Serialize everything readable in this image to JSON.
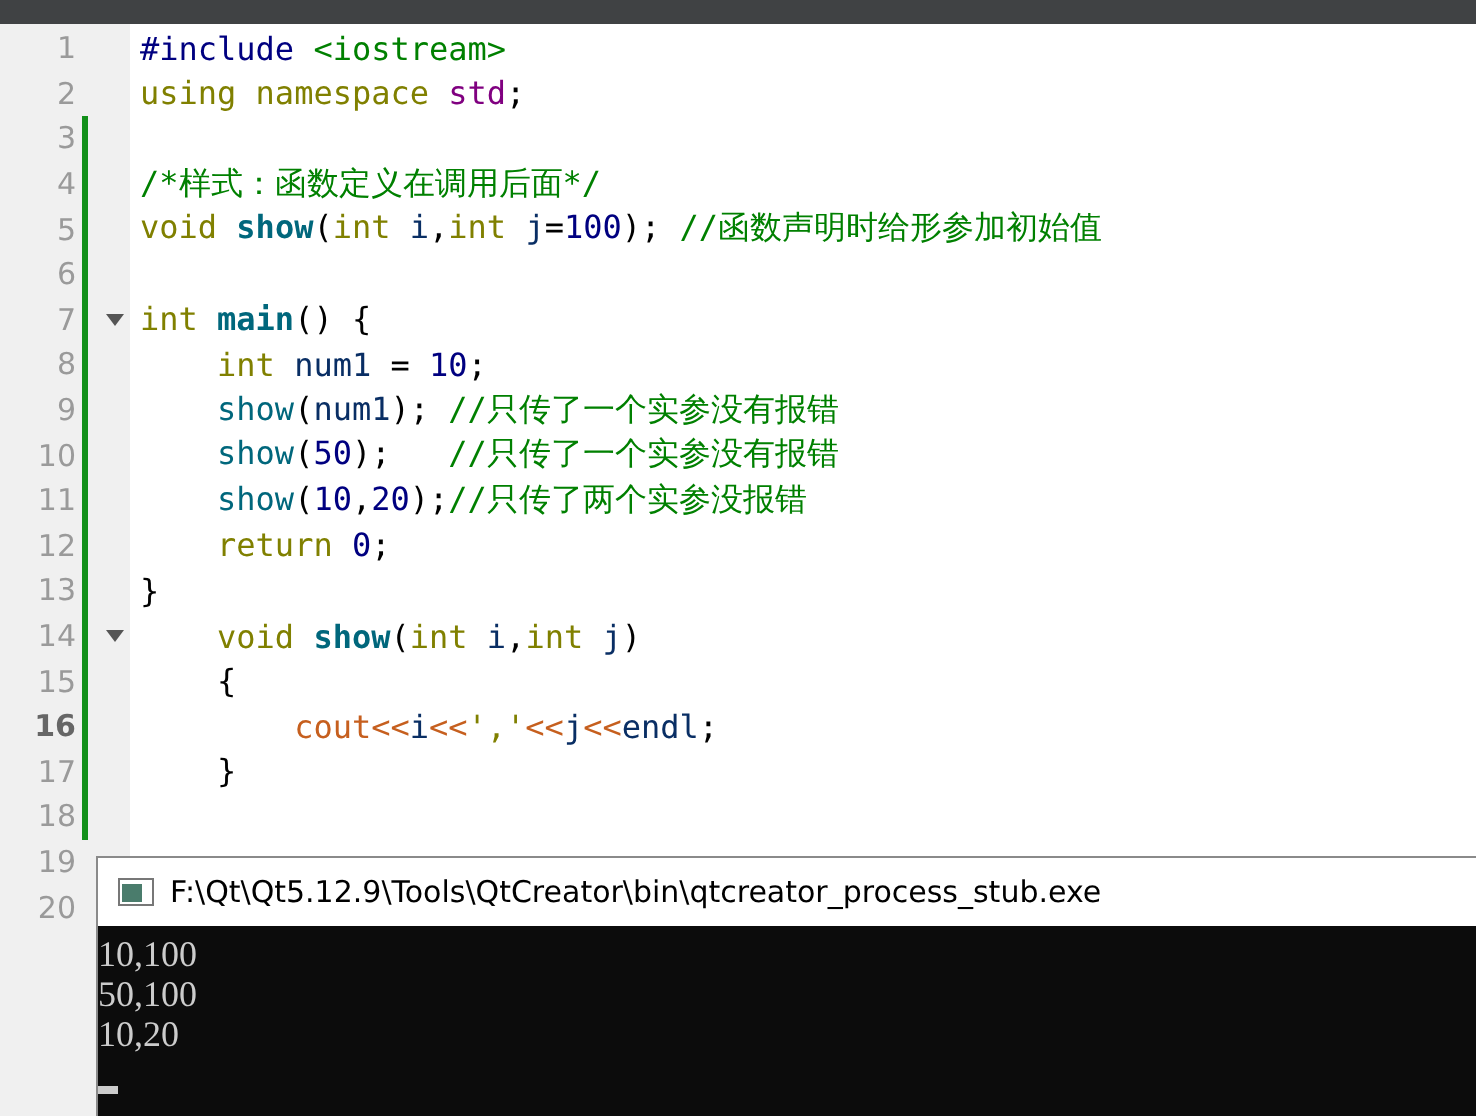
{
  "editor": {
    "lines": [
      {
        "number": "1",
        "current": false,
        "fold": false,
        "modified": false,
        "tokens": [
          {
            "text": "#include ",
            "kind": "pre"
          },
          {
            "text": "<iostream>",
            "kind": "inc"
          }
        ]
      },
      {
        "number": "2",
        "current": false,
        "fold": false,
        "modified": false,
        "tokens": [
          {
            "text": "using namespace ",
            "kind": "kw"
          },
          {
            "text": "std",
            "kind": "ns"
          },
          {
            "text": ";",
            "kind": "plain"
          }
        ]
      },
      {
        "number": "3",
        "current": false,
        "fold": false,
        "modified": true
      },
      {
        "number": "4",
        "current": false,
        "fold": false,
        "modified": true,
        "tokens": [
          {
            "text": "/*样式：函数定义在调用后面*/",
            "kind": "cmt"
          }
        ]
      },
      {
        "number": "5",
        "current": false,
        "fold": false,
        "modified": true,
        "tokens": [
          {
            "text": "void ",
            "kind": "kw"
          },
          {
            "text": "show",
            "kind": "fndef"
          },
          {
            "text": "(",
            "kind": "plain"
          },
          {
            "text": "int ",
            "kind": "kw"
          },
          {
            "text": "i",
            "kind": "id"
          },
          {
            "text": ",",
            "kind": "plain"
          },
          {
            "text": "int ",
            "kind": "kw"
          },
          {
            "text": "j",
            "kind": "id"
          },
          {
            "text": "=",
            "kind": "plain"
          },
          {
            "text": "100",
            "kind": "num"
          },
          {
            "text": "); ",
            "kind": "plain"
          },
          {
            "text": "//函数声明时给形参加初始值",
            "kind": "cmt"
          }
        ]
      },
      {
        "number": "6",
        "current": false,
        "fold": false,
        "modified": true
      },
      {
        "number": "7",
        "current": false,
        "fold": true,
        "modified": true,
        "tokens": [
          {
            "text": "int ",
            "kind": "kw"
          },
          {
            "text": "main",
            "kind": "fndef"
          },
          {
            "text": "() {",
            "kind": "plain"
          }
        ]
      },
      {
        "number": "8",
        "current": false,
        "fold": false,
        "modified": true,
        "tokens": [
          {
            "text": "    int ",
            "kind": "kw"
          },
          {
            "text": "num1",
            "kind": "id"
          },
          {
            "text": " = ",
            "kind": "plain"
          },
          {
            "text": "10",
            "kind": "num"
          },
          {
            "text": ";",
            "kind": "plain"
          }
        ]
      },
      {
        "number": "9",
        "current": false,
        "fold": false,
        "modified": true,
        "tokens": [
          {
            "text": "    show",
            "kind": "fn"
          },
          {
            "text": "(",
            "kind": "plain"
          },
          {
            "text": "num1",
            "kind": "id"
          },
          {
            "text": "); ",
            "kind": "plain"
          },
          {
            "text": "//只传了一个实参没有报错",
            "kind": "cmt"
          }
        ]
      },
      {
        "number": "10",
        "current": false,
        "fold": false,
        "modified": true,
        "tokens": [
          {
            "text": "    show",
            "kind": "fn"
          },
          {
            "text": "(",
            "kind": "plain"
          },
          {
            "text": "50",
            "kind": "num"
          },
          {
            "text": ");   ",
            "kind": "plain"
          },
          {
            "text": "//只传了一个实参没有报错",
            "kind": "cmt"
          }
        ]
      },
      {
        "number": "11",
        "current": false,
        "fold": false,
        "modified": true,
        "tokens": [
          {
            "text": "    show",
            "kind": "fn"
          },
          {
            "text": "(",
            "kind": "plain"
          },
          {
            "text": "10",
            "kind": "num"
          },
          {
            "text": ",",
            "kind": "plain"
          },
          {
            "text": "20",
            "kind": "num"
          },
          {
            "text": ");",
            "kind": "plain"
          },
          {
            "text": "//只传了两个实参没报错",
            "kind": "cmt"
          }
        ]
      },
      {
        "number": "12",
        "current": false,
        "fold": false,
        "modified": true,
        "tokens": [
          {
            "text": "    return ",
            "kind": "kw"
          },
          {
            "text": "0",
            "kind": "num"
          },
          {
            "text": ";",
            "kind": "plain"
          }
        ]
      },
      {
        "number": "13",
        "current": false,
        "fold": false,
        "modified": true,
        "tokens": [
          {
            "text": "}",
            "kind": "plain"
          }
        ]
      },
      {
        "number": "14",
        "current": false,
        "fold": true,
        "modified": true,
        "tokens": [
          {
            "text": "    void ",
            "kind": "kw"
          },
          {
            "text": "show",
            "kind": "fndef"
          },
          {
            "text": "(",
            "kind": "plain"
          },
          {
            "text": "int ",
            "kind": "kw"
          },
          {
            "text": "i",
            "kind": "id"
          },
          {
            "text": ",",
            "kind": "plain"
          },
          {
            "text": "int ",
            "kind": "kw"
          },
          {
            "text": "j",
            "kind": "id"
          },
          {
            "text": ")",
            "kind": "plain"
          }
        ]
      },
      {
        "number": "15",
        "current": false,
        "fold": false,
        "modified": true,
        "tokens": [
          {
            "text": "    {",
            "kind": "plain"
          }
        ]
      },
      {
        "number": "16",
        "current": true,
        "fold": false,
        "modified": true,
        "tokens": [
          {
            "text": "        cout<<",
            "kind": "out"
          },
          {
            "text": "i",
            "kind": "id"
          },
          {
            "text": "<<",
            "kind": "out"
          },
          {
            "text": "','",
            "kind": "chr"
          },
          {
            "text": "<<",
            "kind": "out"
          },
          {
            "text": "j",
            "kind": "id"
          },
          {
            "text": "<<",
            "kind": "out"
          },
          {
            "text": "endl",
            "kind": "id"
          },
          {
            "text": ";",
            "kind": "plain"
          }
        ]
      },
      {
        "number": "17",
        "current": false,
        "fold": false,
        "modified": true,
        "tokens": [
          {
            "text": "    }",
            "kind": "plain"
          }
        ]
      },
      {
        "number": "18",
        "current": false,
        "fold": false,
        "modified": true
      },
      {
        "number": "19",
        "current": false,
        "fold": false,
        "modified": false
      },
      {
        "number": "20",
        "current": false,
        "fold": false,
        "modified": false
      }
    ]
  },
  "console": {
    "title": "F:\\Qt\\Qt5.12.9\\Tools\\QtCreator\\bin\\qtcreator_process_stub.exe",
    "output": [
      "10,100",
      "50,100",
      "10,20"
    ],
    "cursor": true
  }
}
